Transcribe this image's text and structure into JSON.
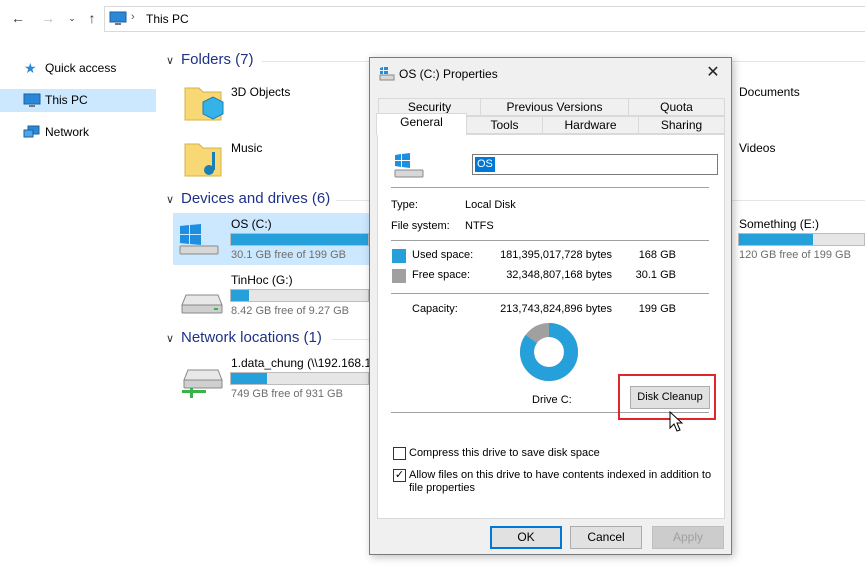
{
  "window": {
    "address": "This PC"
  },
  "sidebar": {
    "items": [
      {
        "label": "Quick access",
        "icon": "star-icon"
      },
      {
        "label": "This PC",
        "icon": "computer-icon",
        "selected": true
      },
      {
        "label": "Network",
        "icon": "network-icon"
      }
    ]
  },
  "folders": {
    "heading": "Folders (7)",
    "items": [
      {
        "label": "3D Objects",
        "icon": "3d-objects-folder-icon"
      },
      {
        "label": "Music",
        "icon": "music-folder-icon"
      },
      {
        "label": "Documents",
        "icon": "documents-folder-icon"
      },
      {
        "label": "Videos",
        "icon": "videos-folder-icon"
      }
    ]
  },
  "devices": {
    "heading": "Devices and drives (6)",
    "items": [
      {
        "label": "OS (C:)",
        "free": "30.1 GB free of 199 GB",
        "used_fraction": 0.85,
        "icon": "windows-drive-icon"
      },
      {
        "label": "TinHoc (G:)",
        "free": "8.42 GB free of 9.27 GB",
        "used_fraction": 0.09,
        "icon": "hard-drive-icon"
      },
      {
        "label": "Something (E:)",
        "free": "120 GB free of 199 GB",
        "used_fraction": 0.4,
        "icon": "hard-drive-icon"
      }
    ]
  },
  "network": {
    "heading": "Network locations (1)",
    "items": [
      {
        "label": "1.data_chung (\\\\192.168.1.",
        "free": "749 GB free of 931 GB",
        "used_fraction": 0.2,
        "icon": "network-drive-icon"
      }
    ]
  },
  "dialog": {
    "title": "OS (C:) Properties",
    "tabs_row1": [
      "Security",
      "Previous Versions",
      "Quota"
    ],
    "tabs_row2": [
      "General",
      "Tools",
      "Hardware",
      "Sharing"
    ],
    "active_tab": "General",
    "name_value": "OS",
    "type_label": "Type:",
    "type_value": "Local Disk",
    "fs_label": "File system:",
    "fs_value": "NTFS",
    "used_label": "Used space:",
    "used_bytes": "181,395,017,728 bytes",
    "used_gb": "168 GB",
    "free_label": "Free space:",
    "free_bytes": "32,348,807,168 bytes",
    "free_gb": "30.1 GB",
    "capacity_label": "Capacity:",
    "capacity_bytes": "213,743,824,896 bytes",
    "capacity_gb": "199 GB",
    "drive_label": "Drive C:",
    "disk_cleanup": "Disk Cleanup",
    "compress_label": "Compress this drive to save disk space",
    "compress_checked": false,
    "index_label_line1": "Allow files on this drive to have contents indexed in addition to",
    "index_label_line2": "file properties",
    "index_checked": true,
    "ok": "OK",
    "cancel": "Cancel",
    "apply": "Apply",
    "used_color": "#26a0da",
    "free_color": "#a0a0a0",
    "used_fraction": 0.8487
  }
}
